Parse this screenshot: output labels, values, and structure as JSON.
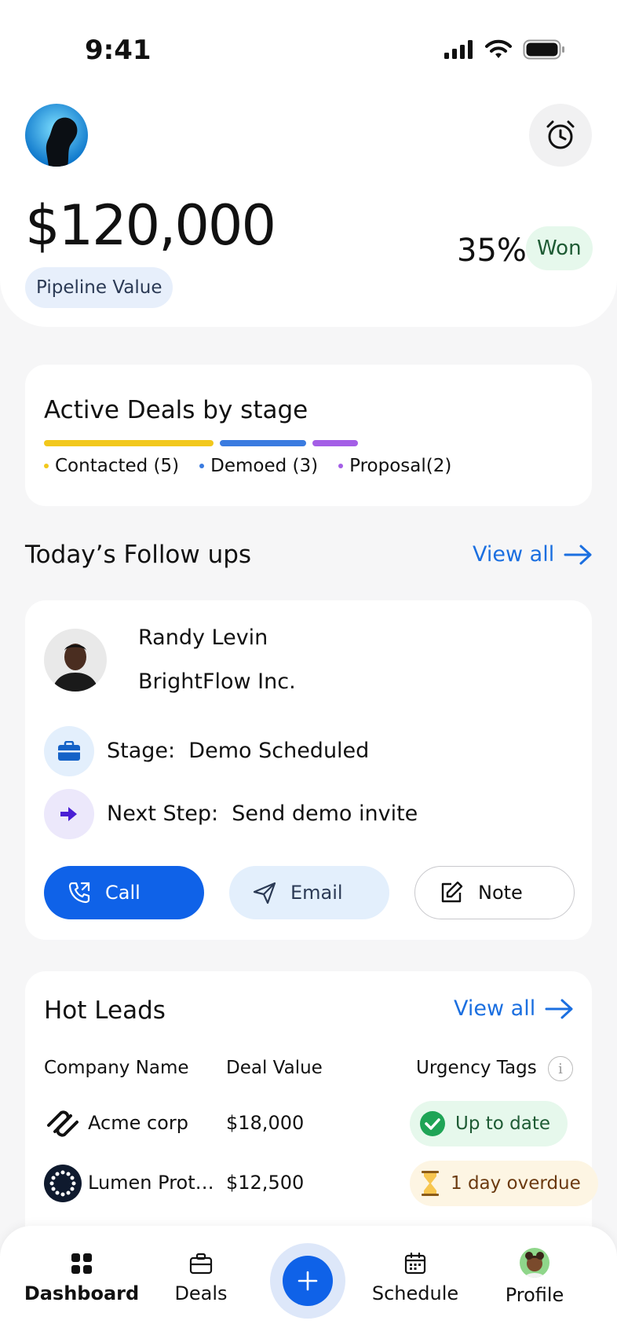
{
  "status_bar": {
    "time": "9:41"
  },
  "header": {
    "pipeline_value": "$120,000",
    "pipeline_label": "Pipeline Value",
    "won_percent": "35%",
    "won_label": "Won"
  },
  "stages": {
    "title": "Active Deals by stage",
    "items": [
      {
        "label": "Contacted (5)",
        "count": 5,
        "color": "#f2c81c"
      },
      {
        "label": "Demoed (3)",
        "count": 3,
        "color": "#3a7be0"
      },
      {
        "label": "Proposal(2)",
        "count": 2,
        "color": "#a45ee6"
      }
    ]
  },
  "followups": {
    "title": "Today’s Follow ups",
    "view_all": "View all",
    "contact": {
      "name": "Randy Levin",
      "company": "BrightFlow Inc.",
      "stage_label": "Stage:",
      "stage_value": "Demo Scheduled",
      "next_label": "Next Step:",
      "next_value": "Send demo invite"
    },
    "actions": {
      "call": "Call",
      "email": "Email",
      "note": "Note"
    }
  },
  "hot_leads": {
    "title": "Hot Leads",
    "view_all": "View all",
    "columns": {
      "company": "Company Name",
      "value": "Deal Value",
      "urgency": "Urgency Tags"
    },
    "rows": [
      {
        "company": "Acme corp",
        "value": "$18,000",
        "tag": "Up to date"
      },
      {
        "company": "Lumen Prot…",
        "value": "$12,500",
        "tag": "1 day overdue"
      }
    ]
  },
  "nav": {
    "dashboard": "Dashboard",
    "deals": "Deals",
    "schedule": "Schedule",
    "profile": "Profile"
  }
}
